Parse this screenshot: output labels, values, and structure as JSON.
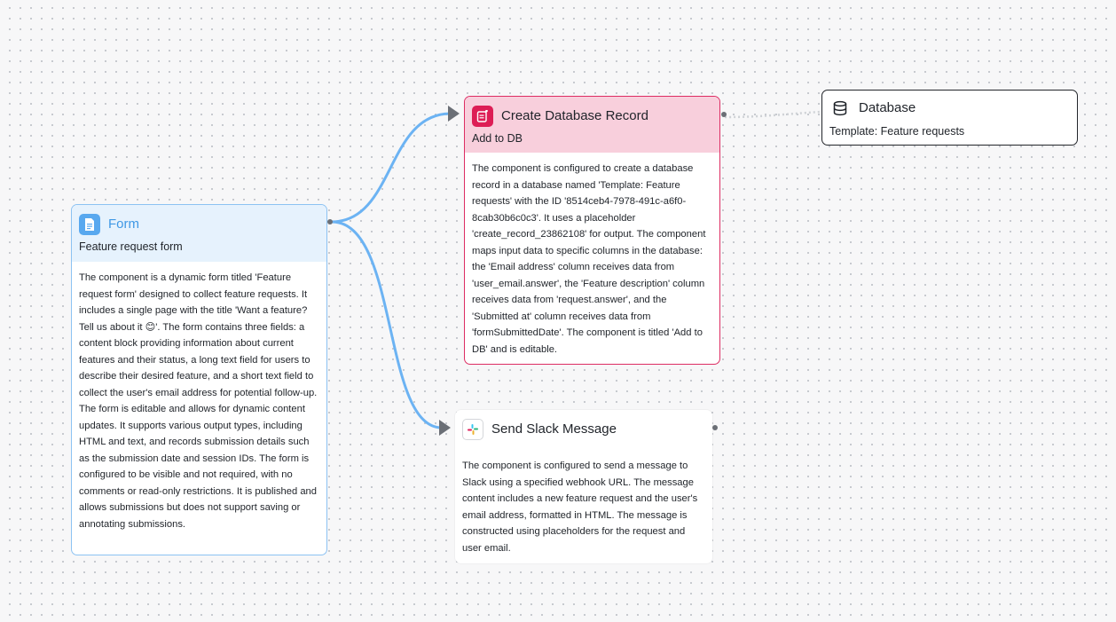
{
  "canvas": {
    "background": "#f7f7f8",
    "edge_color": "#6cb3f3"
  },
  "nodes": {
    "form": {
      "icon": "document-icon",
      "accent_color": "#58a8ef",
      "title": "Form",
      "subtitle": "Feature request form",
      "description": "The component is a dynamic form titled 'Feature request form' designed to collect feature requests. It includes a single page with the title 'Want a feature? Tell us about it 😊'. The form contains three fields: a content block providing information about current features and their status, a long text field for users to describe their desired feature, and a short text field to collect the user's email address for potential follow-up. The form is editable and allows for dynamic content updates. It supports various output types, including HTML and text, and records submission details such as the submission date and session IDs. The form is configured to be visible and not required, with no comments or read-only restrictions. It is published and allows submissions but does not support saving or annotating submissions."
    },
    "create_record": {
      "icon": "database-record-icon",
      "accent_color": "#dd1d55",
      "title": "Create Database Record",
      "subtitle": "Add to DB",
      "description": "The component is configured to create a database record in a database named 'Template: Feature requests' with the ID '8514ceb4-7978-491c-a6f0-8cab30b6c0c3'. It uses a placeholder 'create_record_23862108' for output. The component maps input data to specific columns in the database: the 'Email address' column receives data from 'user_email.answer', the 'Feature description' column receives data from 'request.answer', and the 'Submitted at' column receives data from 'formSubmittedDate'. The component is titled 'Add to DB' and is editable."
    },
    "slack": {
      "icon": "slack-icon",
      "title": "Send Slack Message",
      "description": "The component is configured to send a message to Slack using a specified webhook URL. The message content includes a new feature request and the user's email address, formatted in HTML. The message is constructed using placeholders for the request and user email."
    },
    "database": {
      "icon": "database-icon",
      "title": "Database",
      "subtitle": "Template: Feature requests"
    }
  }
}
